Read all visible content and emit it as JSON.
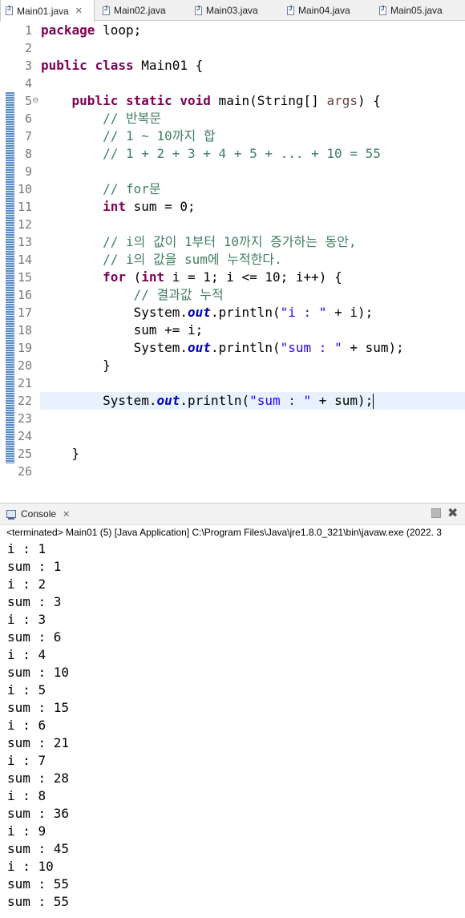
{
  "tabs": [
    {
      "label": "Main01.java",
      "active": true
    },
    {
      "label": "Main02.java",
      "active": false
    },
    {
      "label": "Main03.java",
      "active": false
    },
    {
      "label": "Main04.java",
      "active": false
    },
    {
      "label": "Main05.java",
      "active": false
    }
  ],
  "editor": {
    "lines": [
      {
        "n": "1"
      },
      {
        "n": "2"
      },
      {
        "n": "3"
      },
      {
        "n": "4"
      },
      {
        "n": "5"
      },
      {
        "n": "6"
      },
      {
        "n": "7"
      },
      {
        "n": "8"
      },
      {
        "n": "9"
      },
      {
        "n": "10"
      },
      {
        "n": "11"
      },
      {
        "n": "12"
      },
      {
        "n": "13"
      },
      {
        "n": "14"
      },
      {
        "n": "15"
      },
      {
        "n": "16"
      },
      {
        "n": "17"
      },
      {
        "n": "18"
      },
      {
        "n": "19"
      },
      {
        "n": "20"
      },
      {
        "n": "21"
      },
      {
        "n": "22"
      },
      {
        "n": "23"
      },
      {
        "n": "24"
      },
      {
        "n": "25"
      },
      {
        "n": "26"
      }
    ],
    "code": {
      "l1_kw": "package",
      "l1_rest": " loop;",
      "l3_kw1": "public",
      "l3_kw2": "class",
      "l3_rest": " Main01 {",
      "l5_kw1": "public",
      "l5_kw2": "static",
      "l5_kw3": "void",
      "l5_mid": " main(String[] ",
      "l5_var": "args",
      "l5_end": ") {",
      "l6": "// 반복문",
      "l7": "// 1 ~ 10까지 합",
      "l8": "// 1 + 2 + 3 + 4 + 5 + ... + 10 = 55",
      "l10": "// for문",
      "l11_kw": "int",
      "l11_rest": " sum = 0;",
      "l13": "// i의 값이 1부터 10까지 증가하는 동안,",
      "l14": "// i의 값을 sum에 누적한다.",
      "l15_kw1": "for",
      "l15_a": " (",
      "l15_kw2": "int",
      "l15_b": " i = 1; i <= 10; i++) {",
      "l16": "// 결과값 누적",
      "l17_a": "System.",
      "l17_fd": "out",
      "l17_b": ".println(",
      "l17_st": "\"i : \"",
      "l17_c": " + i);",
      "l18": "sum += i;",
      "l19_a": "System.",
      "l19_fd": "out",
      "l19_b": ".println(",
      "l19_st": "\"sum : \"",
      "l19_c": " + sum);",
      "l20": "}",
      "l22_a": "System.",
      "l22_fd": "out",
      "l22_b": ".println(",
      "l22_st": "\"sum : \"",
      "l22_c": " + sum);",
      "l25": "}"
    }
  },
  "console": {
    "tab_label": "Console",
    "status": "<terminated> Main01 (5) [Java Application] C:\\Program Files\\Java\\jre1.8.0_321\\bin\\javaw.exe (2022. 3",
    "output": [
      "i : 1",
      "sum : 1",
      "i : 2",
      "sum : 3",
      "i : 3",
      "sum : 6",
      "i : 4",
      "sum : 10",
      "i : 5",
      "sum : 15",
      "i : 6",
      "sum : 21",
      "i : 7",
      "sum : 28",
      "i : 8",
      "sum : 36",
      "i : 9",
      "sum : 45",
      "i : 10",
      "sum : 55",
      "sum : 55"
    ]
  },
  "colors": {
    "keyword": "#7f0055",
    "comment": "#3f7f5f",
    "string": "#2a00ff",
    "field": "#0000c0",
    "current_line": "#e8f2fe"
  }
}
